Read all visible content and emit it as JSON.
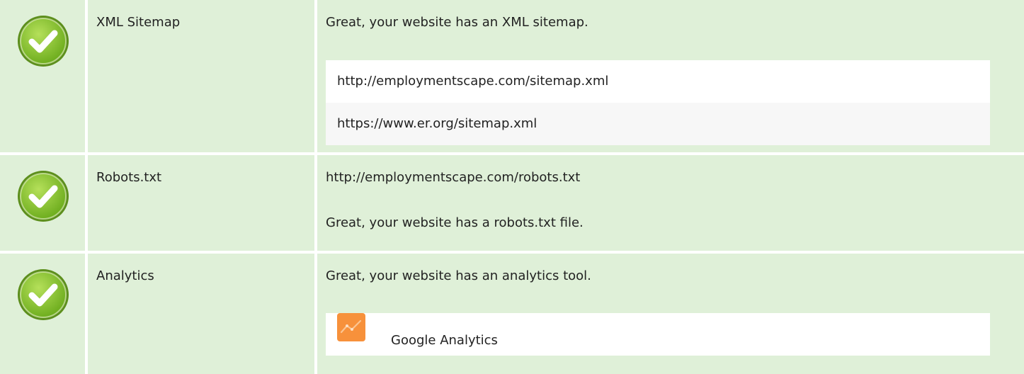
{
  "rows": [
    {
      "status": "pass",
      "icon": "check-icon",
      "name": "XML Sitemap",
      "message": "Great, your website has an XML sitemap.",
      "urls": [
        "http://employmentscape.com/sitemap.xml",
        "https://www.er.org/sitemap.xml"
      ]
    },
    {
      "status": "pass",
      "icon": "check-icon",
      "name": "Robots.txt",
      "url": "http://employmentscape.com/robots.txt",
      "message": "Great, your website has a robots.txt file."
    },
    {
      "status": "pass",
      "icon": "check-icon",
      "name": "Analytics",
      "message": "Great, your website has an analytics tool.",
      "tools": [
        {
          "name": "Google Analytics",
          "icon": "google-analytics-icon"
        }
      ]
    }
  ],
  "colors": {
    "row_background": "#dff0d8",
    "check_green": "#8cc63f",
    "check_border": "#6a9a2a",
    "analytics_orange": "#f7913b"
  }
}
